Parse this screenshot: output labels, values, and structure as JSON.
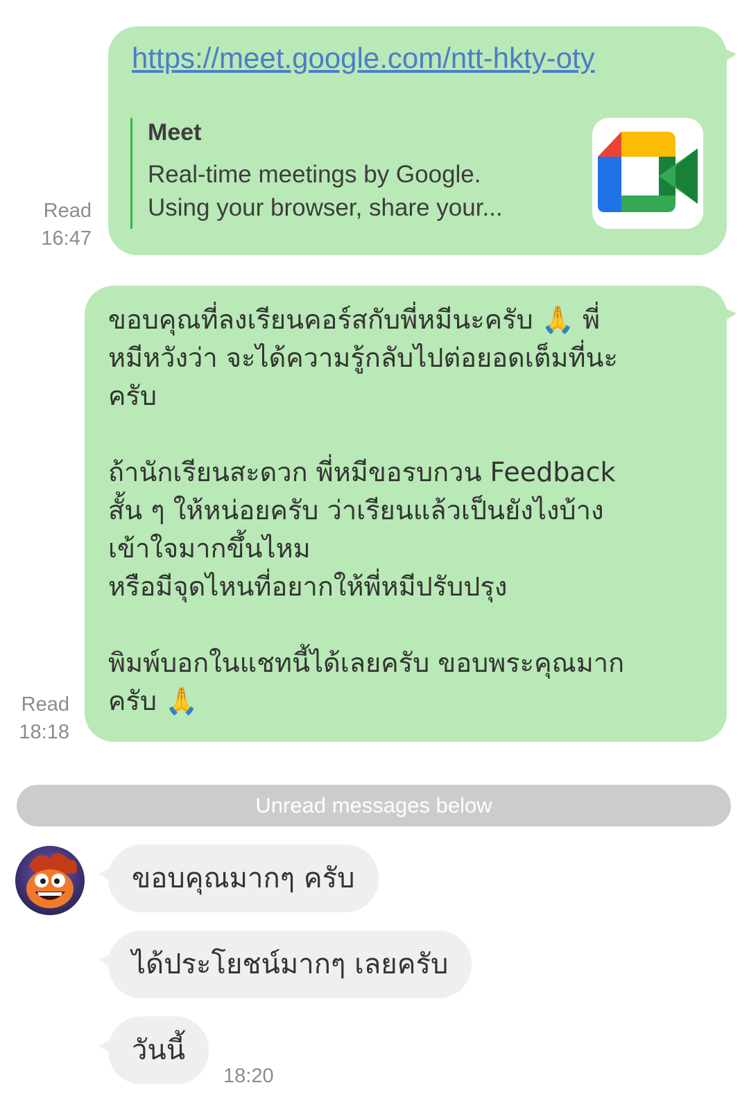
{
  "messages_out": [
    {
      "link": "https://meet.google.com/ntt-hkty-oty",
      "preview": {
        "title": "Meet",
        "desc_line1": "Real-time meetings by Google.",
        "desc_line2": "Using your browser, share your..."
      },
      "thumb_icon": "google-meet-icon",
      "status": "Read",
      "time": "16:47"
    },
    {
      "text": "ขอบคุณที่ลงเรียนคอร์สกับพี่หมีนะครับ 🙏 พี่\nหมีหวังว่า จะได้ความรู้กลับไปต่อยอดเต็มที่นะ\nครับ\n\nถ้านักเรียนสะดวก พี่หมีขอรบกวน Feedback\nสั้น ๆ ให้หน่อยครับ ว่าเรียนแล้วเป็นยังไงบ้าง\nเข้าใจมากขึ้นไหม\nหรือมีจุดไหนที่อยากให้พี่หมีปรับปรุง\n\nพิมพ์บอกในแชทนี้ได้เลยครับ ขอบพระคุณมาก\nครับ 🙏",
      "status": "Read",
      "time": "18:18"
    }
  ],
  "divider": "Unread messages below",
  "messages_in": [
    {
      "text": "ขอบคุณมากๆ ครับ"
    },
    {
      "text": "ได้ประโยชน์มากๆ เลยครับ"
    },
    {
      "text": "วันนี้"
    }
  ],
  "last_time": "18:20",
  "colors": {
    "outgoing_bubble": "#b9e9b6",
    "incoming_bubble": "#eeeff1",
    "divider": "#cccccc",
    "link": "#4d7cc7",
    "preview_bar": "#39b54a"
  }
}
